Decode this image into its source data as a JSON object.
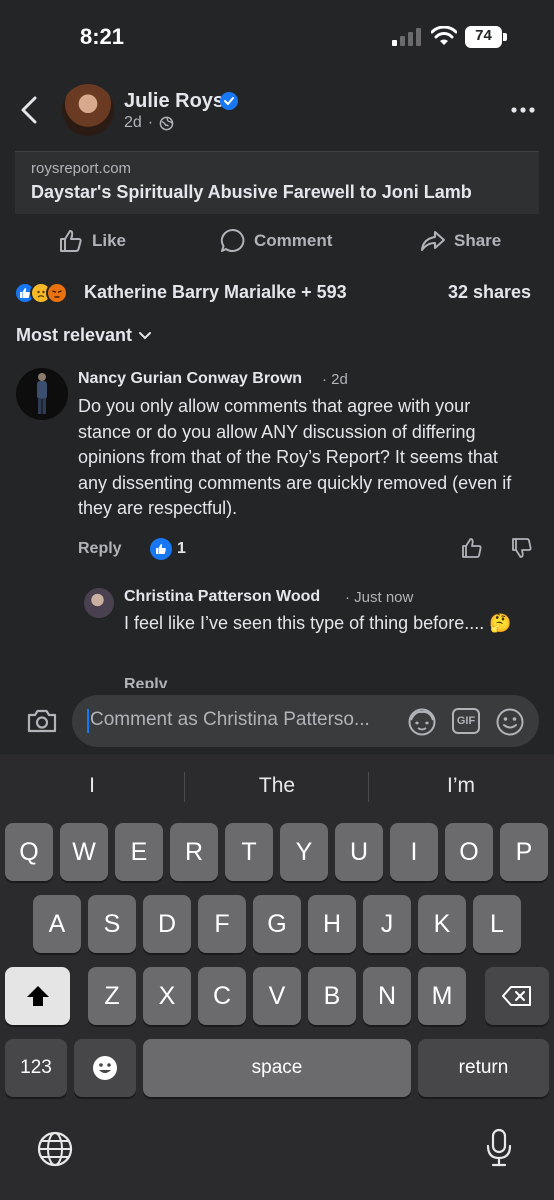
{
  "status": {
    "time": "8:21",
    "battery": "74"
  },
  "post": {
    "author": "Julie Roys",
    "age": "2d",
    "link_domain": "roysreport.com",
    "link_title": "Daystar's Spiritually Abusive Farewell to Joni Lamb"
  },
  "actions": {
    "like": "Like",
    "comment": "Comment",
    "share": "Share"
  },
  "reactions": {
    "names": "Katherine Barry Marialke + 593",
    "shares": "32 shares",
    "icons": [
      "like-icon",
      "sad-icon",
      "angry-icon"
    ]
  },
  "sort": {
    "label": "Most relevant"
  },
  "comments": [
    {
      "author": "Nancy Gurian Conway Brown",
      "time": "· 2d",
      "body": "Do you only allow comments that agree with your stance or do you allow ANY discussion of differing opinions from that of the Roy’s Report?  It seems that any dissenting comments are quickly removed (even if they are respectful).",
      "reply": "Reply",
      "likes": "1"
    },
    {
      "author": "Christina Patterson Wood",
      "time": "· Just now",
      "body": "I feel like I’ve seen this type of thing before.... 🤔",
      "reply": "Reply"
    }
  ],
  "composer": {
    "placeholder": "Comment as Christina Patterso...",
    "gif": "GIF"
  },
  "keyboard": {
    "suggestions": [
      "I",
      "The",
      "I’m"
    ],
    "row1": [
      "Q",
      "W",
      "E",
      "R",
      "T",
      "Y",
      "U",
      "I",
      "O",
      "P"
    ],
    "row2": [
      "A",
      "S",
      "D",
      "F",
      "G",
      "H",
      "J",
      "K",
      "L"
    ],
    "row3": [
      "Z",
      "X",
      "C",
      "V",
      "B",
      "N",
      "M"
    ],
    "numbers": "123",
    "space": "space",
    "return": "return"
  },
  "colors": {
    "background": "#242526",
    "accent": "#1877f2",
    "text": "#e4e6eb",
    "secondary": "#b0b3b8"
  }
}
